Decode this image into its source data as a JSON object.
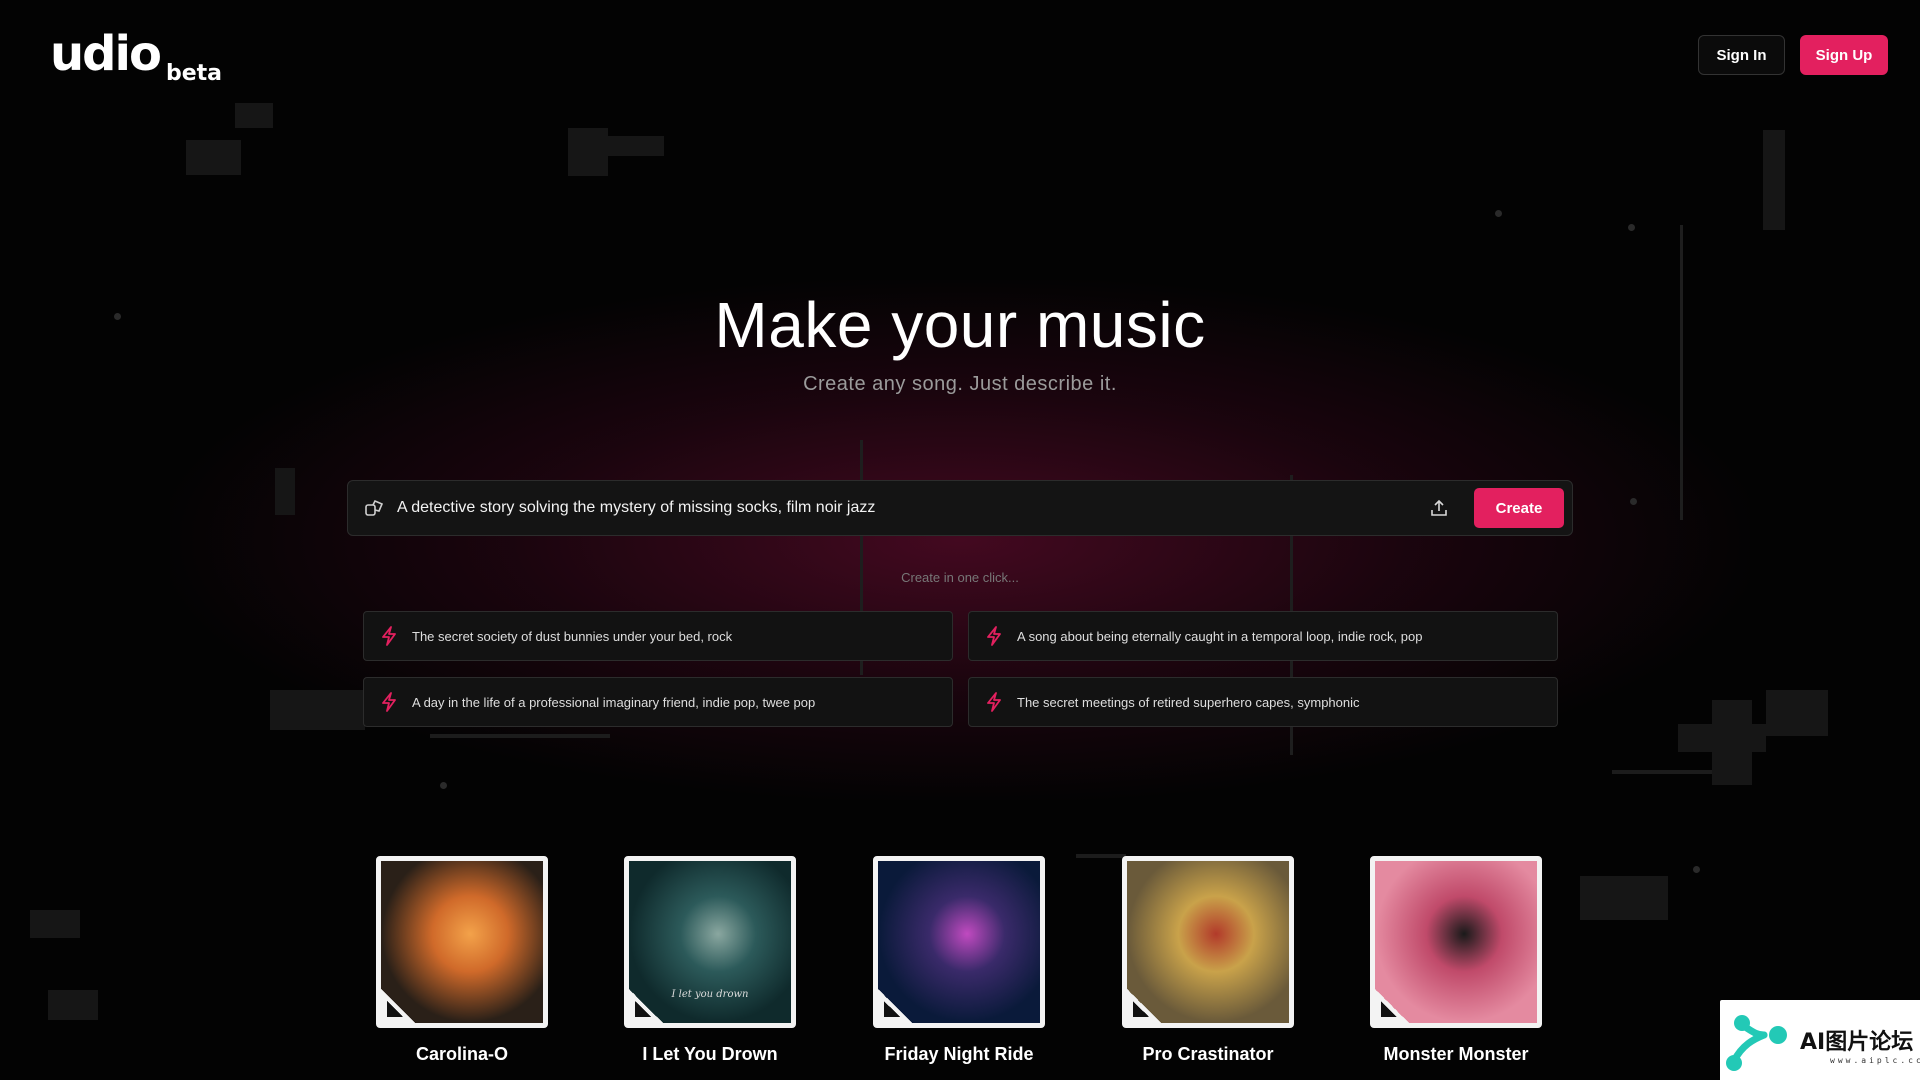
{
  "header": {
    "logo_text": "udio",
    "logo_badge": "beta",
    "sign_in_label": "Sign In",
    "sign_up_label": "Sign Up"
  },
  "hero": {
    "title": "Make your music",
    "subtitle": "Create any song. Just describe it."
  },
  "prompt": {
    "value": "A detective story solving the mystery of missing socks, film noir jazz",
    "create_label": "Create"
  },
  "one_click_label": "Create in one click...",
  "suggestions": [
    {
      "text": "The secret society of dust bunnies under your bed, rock"
    },
    {
      "text": "A song about being eternally caught in a temporal loop, indie rock, pop"
    },
    {
      "text": "A day in the life of a professional imaginary friend, indie pop, twee pop"
    },
    {
      "text": "The secret meetings of retired superhero capes, symphonic"
    }
  ],
  "songs": [
    {
      "title": "Carolina-O",
      "cover_palette": [
        "#2a2018",
        "#d06a2a",
        "#f3a24a",
        "#5a3a2a"
      ]
    },
    {
      "title": "I Let You Drown",
      "cover_palette": [
        "#0f2a2c",
        "#2c5a5a",
        "#8aa7a0",
        "#0a1414"
      ],
      "cover_caption": "I let you drown"
    },
    {
      "title": "Friday Night Ride",
      "cover_palette": [
        "#0a1a3a",
        "#3a2a6a",
        "#c04ac0",
        "#e07a3a"
      ]
    },
    {
      "title": "Pro Crastinator",
      "cover_palette": [
        "#6a5a3a",
        "#c9a24a",
        "#b23a2a",
        "#2a2a2a"
      ]
    },
    {
      "title": "Monster Monster",
      "cover_palette": [
        "#e48aa0",
        "#c04a6a",
        "#1a1a1a",
        "#f3c2c8"
      ]
    }
  ],
  "watermark": {
    "text": "AI图片论坛",
    "sub": "www.aiplc.cc"
  },
  "colors": {
    "accent": "#e3205f",
    "background": "#030303"
  }
}
